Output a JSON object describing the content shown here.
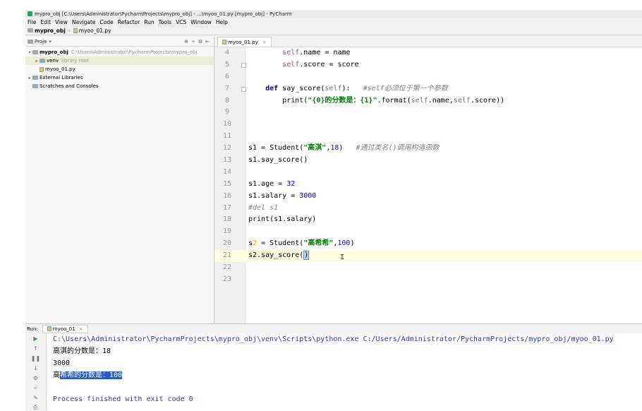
{
  "window": {
    "title": "mypro_obj [C:\\Users\\Administrator\\PycharmProjects\\mypro_obj] - ...\\myoo_01.py [mypro_obj] - PyCharm"
  },
  "menu": [
    "File",
    "Edit",
    "View",
    "Navigate",
    "Code",
    "Refactor",
    "Run",
    "Tools",
    "VCS",
    "Window",
    "Help"
  ],
  "breadcrumb": {
    "project": "mypro_obj",
    "file": "myoo_01.py"
  },
  "project_panel": {
    "title": "Proje",
    "tree": [
      {
        "label": "mypro_obj",
        "dim": "C:\\Users\\Administrator\\PycharmProjects\\mypro_obj",
        "level": 0,
        "arrow": "▾",
        "icon": "folder"
      },
      {
        "label": "venv",
        "dim": "library root",
        "level": 1,
        "arrow": "▸",
        "icon": "folder"
      },
      {
        "label": "myoo_01.py",
        "dim": "",
        "level": 1,
        "arrow": "",
        "icon": "py"
      },
      {
        "label": "External Libraries",
        "dim": "",
        "level": 0,
        "arrow": "▸",
        "icon": "library"
      },
      {
        "label": "Scratches and Consoles",
        "dim": "",
        "level": 0,
        "arrow": "",
        "icon": "scratch"
      }
    ]
  },
  "editor": {
    "tab": "myoo_01.py",
    "lines": [
      {
        "n": "4",
        "html": "        <span class='self'>self</span>.name = name"
      },
      {
        "n": "5",
        "html": "        <span class='self'>self</span>.score = score"
      },
      {
        "n": "6",
        "html": ""
      },
      {
        "n": "7",
        "html": "    <span class='kw'>def</span> say_score(<span class='self'>self</span>):   <span class='cmt'>#self必须位于第一个参数</span>"
      },
      {
        "n": "8",
        "html": "        print(<span class='str'>\"{0}的分数是：{1}\"</span>.format(<span class='self'>self</span>.name,<span class='self'>self</span>.score))"
      },
      {
        "n": "9",
        "html": ""
      },
      {
        "n": "10",
        "html": ""
      },
      {
        "n": "11",
        "html": ""
      },
      {
        "n": "12",
        "html": "s1 = Student(<span class='str'>\"高淇\"</span>,<span class='num'>18</span>)   <span class='cmt'>#通过类名()调用构造函数</span>"
      },
      {
        "n": "13",
        "html": "s1.say_score()"
      },
      {
        "n": "14",
        "html": ""
      },
      {
        "n": "15",
        "html": "s1.age = <span class='num'>32</span>"
      },
      {
        "n": "16",
        "html": "s1.salary = <span class='num'>3000</span>"
      },
      {
        "n": "17",
        "html": "<span class='cmt'>#del s1</span>"
      },
      {
        "n": "18",
        "html": "print(s1.salary)"
      },
      {
        "n": "19",
        "html": ""
      },
      {
        "n": "20",
        "html": "s<span class='warn-bulb'>2</span> = Student(<span class='str'>\"高希希\"</span>,<span class='num'>100</span>)"
      },
      {
        "n": "21",
        "html": "s2.say_score(<span class='brk'>)</span>",
        "current": true
      },
      {
        "n": "22",
        "html": ""
      },
      {
        "n": "23",
        "html": ""
      }
    ]
  },
  "run": {
    "label": "Run:",
    "tab": "myoo_01",
    "console": {
      "cmd": "C:\\Users\\Administrator\\PycharmProjects\\mypro_obj\\venv\\Scripts\\python.exe C:/Users/Administrator/PycharmProjects/mypro_obj/myoo_01.py",
      "out1": "高淇的分数是：18",
      "out2": "3000",
      "out3_prefix": "高",
      "out3_selected": "希希的分数是：100",
      "finish": "Process finished with exit code 0"
    }
  }
}
